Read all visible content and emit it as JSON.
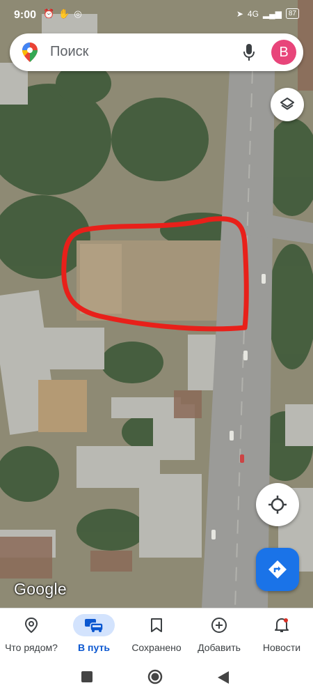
{
  "status_bar": {
    "time": "9:00",
    "network": "4G",
    "battery": "87"
  },
  "search": {
    "placeholder": "Поиск",
    "account_initial": "B"
  },
  "map": {
    "logo_text": "Google",
    "highlight_color": "#e8201a"
  },
  "bottom_nav": {
    "items": [
      {
        "label": "Что рядом?",
        "icon": "location-pin-icon"
      },
      {
        "label": "В путь",
        "icon": "car-icon",
        "active": true
      },
      {
        "label": "Сохранено",
        "icon": "bookmark-icon"
      },
      {
        "label": "Добавить",
        "icon": "add-circle-icon"
      },
      {
        "label": "Новости",
        "icon": "bell-icon"
      }
    ]
  },
  "colors": {
    "accent": "#1a73e8",
    "active_pill": "#d3e3fd",
    "avatar": "#e8457a"
  }
}
